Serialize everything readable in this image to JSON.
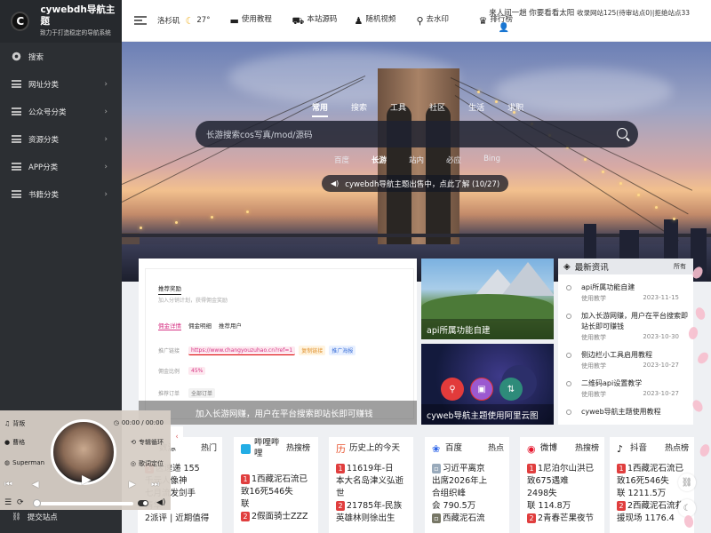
{
  "brand": {
    "logo_letter": "C",
    "title": "cywebdh导航主题",
    "subtitle": "致力于打造稳定的导航系统"
  },
  "sidebar": {
    "items": [
      {
        "label": "搜索",
        "icon": "search-icon",
        "has_arrow": false
      },
      {
        "label": "网址分类",
        "icon": "list-icon",
        "has_arrow": true
      },
      {
        "label": "公众号分类",
        "icon": "list-icon",
        "has_arrow": true
      },
      {
        "label": "资源分类",
        "icon": "list-icon",
        "has_arrow": true
      },
      {
        "label": "APP分类",
        "icon": "list-icon",
        "has_arrow": true
      },
      {
        "label": "书籍分类",
        "icon": "list-icon",
        "has_arrow": true
      }
    ],
    "submit_label": "提交站点"
  },
  "topbar": {
    "city": "洛杉矶",
    "temperature": "27°",
    "links": [
      {
        "label": "使用教程",
        "icon": "book-icon"
      },
      {
        "label": "本站源码",
        "icon": "cart-icon"
      },
      {
        "label": "随机视频",
        "icon": "person-icon"
      },
      {
        "label": "去水印",
        "icon": "pin-icon"
      },
      {
        "label": "排行榜",
        "icon": "trophy-icon"
      }
    ],
    "greeting": "来人间一趟 你要看看太阳",
    "stats": "收录网站125(待审站点0)|拒绝站点33"
  },
  "hero": {
    "tabs": [
      "常用",
      "搜索",
      "工具",
      "社区",
      "生活",
      "求职"
    ],
    "active_tab": "常用",
    "search_placeholder": "长游搜索cos写真/mod/源码",
    "engines": [
      "百度",
      "长游",
      "站内",
      "必应",
      "Bing"
    ],
    "active_engine": "长游",
    "notice": "cywebdh导航主题出售中，点此了解 (10/27)"
  },
  "feature": {
    "caption": "加入长游网赚，用户在平台搜索即站长即可赚钱",
    "mock": {
      "title": "推荐奖励",
      "desc": "加入分销计划，获得佣金奖励",
      "tabs": [
        "佣金详情",
        "佣金明细",
        "推荐用户"
      ],
      "link_label": "推广链接",
      "link": "https://www.changyouzuhao.cn?ref=1",
      "copy_label": "复制链接",
      "poster_label": "推广海报",
      "ratio_label": "佣金比例",
      "ratio": "45%",
      "orders_label": "推荐订单",
      "orders_value": "全部订单"
    }
  },
  "cards": [
    {
      "caption": "api所属功能自建"
    },
    {
      "caption": "cyweb导航主题使用阿里云图"
    }
  ],
  "news": {
    "title": "最新资讯",
    "more": "所有",
    "items": [
      {
        "title": "api所属功能自建",
        "category": "使用教学",
        "date": "2023-11-15"
      },
      {
        "title": "加入长游网赚，用户在平台搜索即站长即可赚钱",
        "category": "使用教学",
        "date": "2023-10-30"
      },
      {
        "title": "侧边栏小工具启用教程",
        "category": "使用教学",
        "date": "2023-10-27"
      },
      {
        "title": "二维码api设置教学",
        "category": "使用教学",
        "date": "2023-10-27"
      },
      {
        "title": "cyweb导航主题使用教程",
        "category": "",
        "date": ""
      }
    ]
  },
  "hotlists": [
    {
      "name": "数源",
      "tag": "热门",
      "icon": "",
      "color": "#ffffff",
      "lines": [
        "区速递 155",
        "千元人像神",
        "七月流发剑手",
        "清华"
      ],
      "rank2": "2派评 | 近期值得"
    },
    {
      "name": "哔哩哔哩",
      "tag": "热搜榜",
      "icon": "bilibili-icon",
      "color": "#23ade5",
      "lines": [
        "1西藏泥石流已",
        "致16死546失",
        "联"
      ],
      "rank2": "2假面骑士ZZZ"
    },
    {
      "name": "历史上的今天",
      "tag": "",
      "icon": "history-icon",
      "color": "#e8542f",
      "lines": [
        "11619年-日",
        "本大名岛津义弘逝",
        "世",
        "21785年-民族",
        "英雄林则徐出生"
      ],
      "rank2": ""
    },
    {
      "name": "百度",
      "tag": "热点",
      "icon": "baidu-icon",
      "color": "#2a62e8",
      "lines": [
        "习近平离京",
        "出席2026年上",
        "合组织峰",
        "会 790.5万",
        "西藏泥石流"
      ],
      "rank2": ""
    },
    {
      "name": "微博",
      "tag": "热搜榜",
      "icon": "weibo-icon",
      "color": "#e6162d",
      "lines": [
        "1尼泊尔山洪已",
        "致675遇难",
        "2498失",
        "联 114.8万",
        "2青春芒果夜节"
      ],
      "rank2": ""
    },
    {
      "name": "抖音",
      "tag": "热点榜",
      "icon": "douyin-icon",
      "color": "#111111",
      "lines": [
        "1西藏泥石流已",
        "致16死546失",
        "联 1211.5万",
        "2西藏泥石流救",
        "援现场 1176.4"
      ],
      "rank2": ""
    }
  ],
  "player": {
    "song": "背叛",
    "artist": "曹格",
    "album": "Superman",
    "time": "00:00 / 00:00",
    "mode": "专辑循环",
    "lyric_locate": "歌词定位",
    "play_state": "paused"
  },
  "colors": {
    "sidebar_bg": "#2c2f33",
    "accent_red": "#e03e3e",
    "link_pink": "#d63384"
  }
}
